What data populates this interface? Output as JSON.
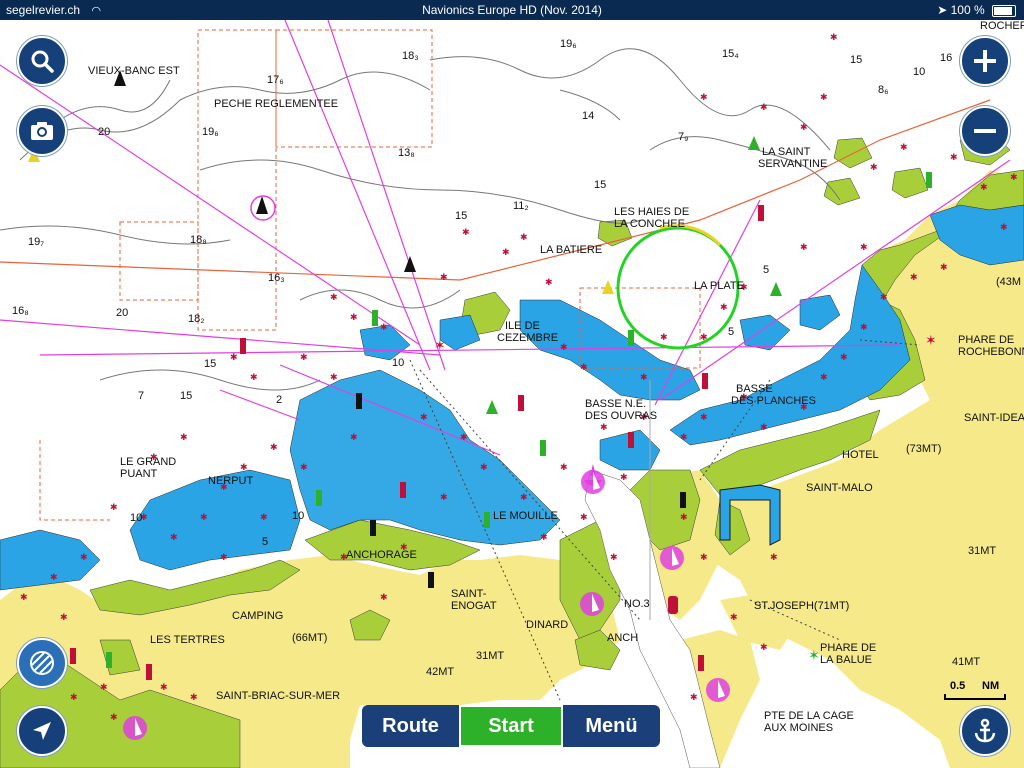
{
  "status_bar": {
    "carrier": "segelrevier.ch",
    "title": "Navionics Europe HD (Nov. 2014)",
    "battery": "100 %",
    "battery_level": 1.0
  },
  "toolbar": {
    "route_label": "Route",
    "start_label": "Start",
    "menu_label": "Menü"
  },
  "scale": {
    "value": "0.5",
    "unit": "NM"
  },
  "icons": {
    "search": "search-icon",
    "camera": "camera-icon",
    "zoom_in": "plus-icon",
    "zoom_out": "minus-icon",
    "layers": "layers-icon",
    "locate": "navigation-arrow-icon",
    "anchor": "anchor-icon"
  },
  "colors": {
    "land": "#f5e98a",
    "shallow_water": "#2aa4e4",
    "drying": "#a8cf3a",
    "deep_water": "#ffffff",
    "toolbar": "#1b3f78",
    "start": "#2db12a",
    "route_line": "#e040e0",
    "limit_line": "#e8643a"
  },
  "labels": [
    {
      "id": "vieux-banc",
      "text": "VIEUX-BANC EST"
    },
    {
      "id": "peche",
      "text": "PECHE REGLEMENTEE"
    },
    {
      "id": "la-saint-serv-1",
      "text": "LA SAINT"
    },
    {
      "id": "la-saint-serv-2",
      "text": "SERVANTINE"
    },
    {
      "id": "haies-1",
      "text": "LES HAIES DE"
    },
    {
      "id": "haies-2",
      "text": "LA CONCHEE"
    },
    {
      "id": "la-batiere",
      "text": "LA BATIERE"
    },
    {
      "id": "la-plate",
      "text": "LA PLATE"
    },
    {
      "id": "ile-1",
      "text": "ILE DE"
    },
    {
      "id": "ile-2",
      "text": "CEZEMBRE"
    },
    {
      "id": "phare-roch-1",
      "text": "PHARE DE"
    },
    {
      "id": "phare-roch-2",
      "text": "ROCHEBONNE"
    },
    {
      "id": "basse-planches-1",
      "text": "BASSE"
    },
    {
      "id": "basse-planches-2",
      "text": "DES PLANCHES"
    },
    {
      "id": "basse-ouvras-1",
      "text": "BASSE N.E."
    },
    {
      "id": "basse-ouvras-2",
      "text": "DES OUVRAS"
    },
    {
      "id": "saint-idea",
      "text": "SAINT-IDEA"
    },
    {
      "id": "hotel",
      "text": "HOTEL"
    },
    {
      "id": "73mt",
      "text": "(73MT)"
    },
    {
      "id": "le-grand-1",
      "text": "LE GRAND"
    },
    {
      "id": "le-grand-2",
      "text": "PUANT"
    },
    {
      "id": "nerput",
      "text": "NERPUT"
    },
    {
      "id": "saint-malo",
      "text": "SAINT-MALO"
    },
    {
      "id": "le-mouille",
      "text": "LE MOUILLE"
    },
    {
      "id": "anchorage",
      "text": "ANCHORAGE"
    },
    {
      "id": "saint-enogat-1",
      "text": "SAINT-"
    },
    {
      "id": "saint-enogat-2",
      "text": "ENOGAT"
    },
    {
      "id": "dinard",
      "text": "DINARD"
    },
    {
      "id": "anch",
      "text": "ANCH"
    },
    {
      "id": "no3",
      "text": "NO.3"
    },
    {
      "id": "st-joseph",
      "text": "ST.JOSEPH(71MT)"
    },
    {
      "id": "camping",
      "text": "CAMPING"
    },
    {
      "id": "les-tertres",
      "text": "LES TERTRES"
    },
    {
      "id": "66mt",
      "text": "(66MT)"
    },
    {
      "id": "42mt",
      "text": "42MT"
    },
    {
      "id": "31mt-a",
      "text": "31MT"
    },
    {
      "id": "31mt-b",
      "text": "31MT"
    },
    {
      "id": "41mt",
      "text": "41MT"
    },
    {
      "id": "phare-balue-1",
      "text": "PHARE DE"
    },
    {
      "id": "phare-balue-2",
      "text": "LA BALUE"
    },
    {
      "id": "saint-briac",
      "text": "SAINT-BRIAC-SUR-MER"
    },
    {
      "id": "pte-cage-1",
      "text": "PTE DE LA CAGE"
    },
    {
      "id": "pte-cage-2",
      "text": "AUX MOINES"
    },
    {
      "id": "43m",
      "text": "(43M"
    },
    {
      "id": "roche-top",
      "text": "ROCHEP"
    }
  ],
  "soundings": [
    {
      "id": "s1",
      "text": "19₆"
    },
    {
      "id": "s2",
      "text": "18₃"
    },
    {
      "id": "s3",
      "text": "17₆"
    },
    {
      "id": "s4",
      "text": "15₄"
    },
    {
      "id": "s5",
      "text": "15"
    },
    {
      "id": "s6",
      "text": "16"
    },
    {
      "id": "s7",
      "text": "10"
    },
    {
      "id": "s8",
      "text": "8₆"
    },
    {
      "id": "s9",
      "text": "20"
    },
    {
      "id": "s10",
      "text": "19₆"
    },
    {
      "id": "s11",
      "text": "13₈"
    },
    {
      "id": "s12",
      "text": "14"
    },
    {
      "id": "s13",
      "text": "7₉"
    },
    {
      "id": "s14",
      "text": "15"
    },
    {
      "id": "s15",
      "text": "15"
    },
    {
      "id": "s16",
      "text": "11₂"
    },
    {
      "id": "s17",
      "text": "19₇"
    },
    {
      "id": "s18",
      "text": "18₈"
    },
    {
      "id": "s19",
      "text": "16₃"
    },
    {
      "id": "s20",
      "text": "16₈"
    },
    {
      "id": "s21",
      "text": "20"
    },
    {
      "id": "s22",
      "text": "18₂"
    },
    {
      "id": "s23",
      "text": "15"
    },
    {
      "id": "s24",
      "text": "10"
    },
    {
      "id": "s25",
      "text": "15"
    },
    {
      "id": "s26",
      "text": "7"
    },
    {
      "id": "s27",
      "text": "5"
    },
    {
      "id": "s28",
      "text": "5"
    },
    {
      "id": "s29",
      "text": "10"
    },
    {
      "id": "s30",
      "text": "5"
    },
    {
      "id": "s31",
      "text": "2"
    },
    {
      "id": "s32",
      "text": "10"
    }
  ]
}
